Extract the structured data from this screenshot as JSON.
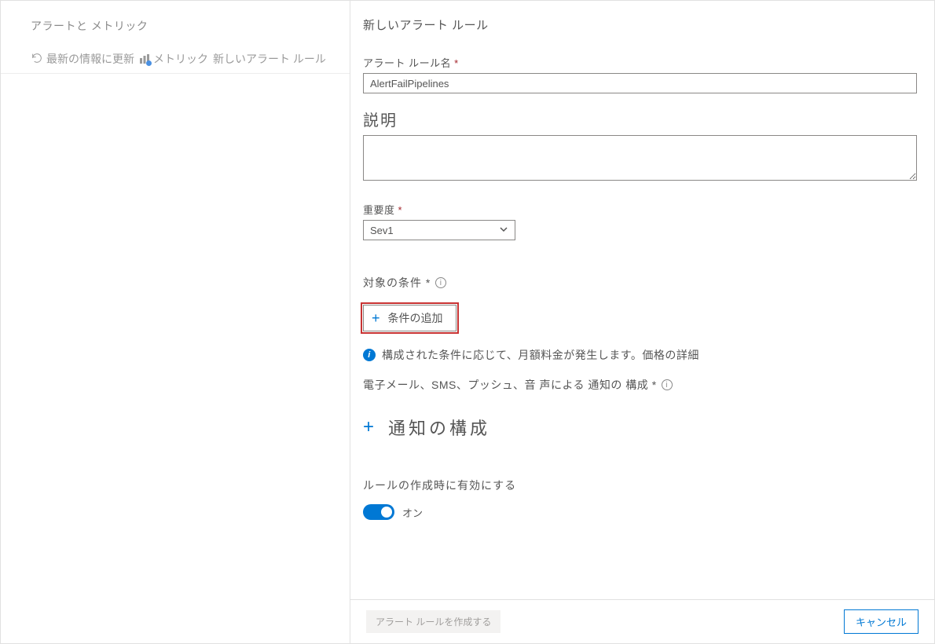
{
  "sidebar": {
    "title": "アラートと メトリック",
    "refresh": "最新の情報に更新",
    "metrics": "メトリック",
    "new_rule": "新しいアラート ルール"
  },
  "form": {
    "title": "新しいアラート ルール",
    "name_label": "アラート ルール名",
    "name_value": "AlertFailPipelines",
    "desc_label": "説明",
    "desc_value": "",
    "severity_label": "重要度",
    "severity_value": "Sev1",
    "criteria_label": "対象の条件 *",
    "add_criteria": "条件の追加",
    "pricing_info": "構成された条件に応じて、月額料金が発生します。価格の詳細",
    "notif_label": "電子メール、SMS、プッシュ、音 声による 通知の 構成 *",
    "notif_config": "通知の構成",
    "enable_label": "ルールの作成時に有効にする",
    "toggle_state": "オン"
  },
  "footer": {
    "create": "アラート ルールを作成する",
    "cancel": "キャンセル"
  }
}
